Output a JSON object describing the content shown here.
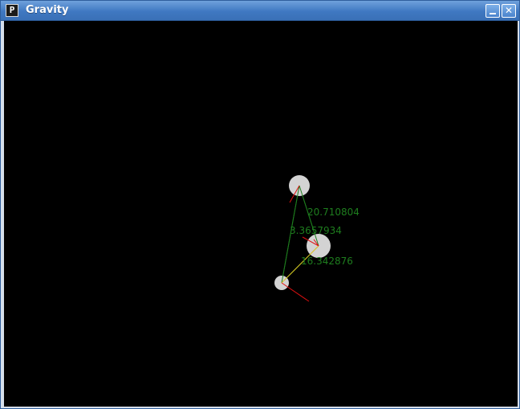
{
  "window": {
    "title": "Gravity",
    "app_icon_glyph": "P",
    "minimize_icon": "minimize-icon",
    "close_icon": "close-icon",
    "close_glyph": "✕"
  },
  "simulation": {
    "background_color": "#000000",
    "body_color": "#d3d3d3",
    "link_color": "#1e7d1e",
    "velocity_color": "#e01010",
    "force_color": "#d8c020",
    "distance_labels": [
      "20.710804",
      "3.3657934",
      "16.342876"
    ]
  }
}
